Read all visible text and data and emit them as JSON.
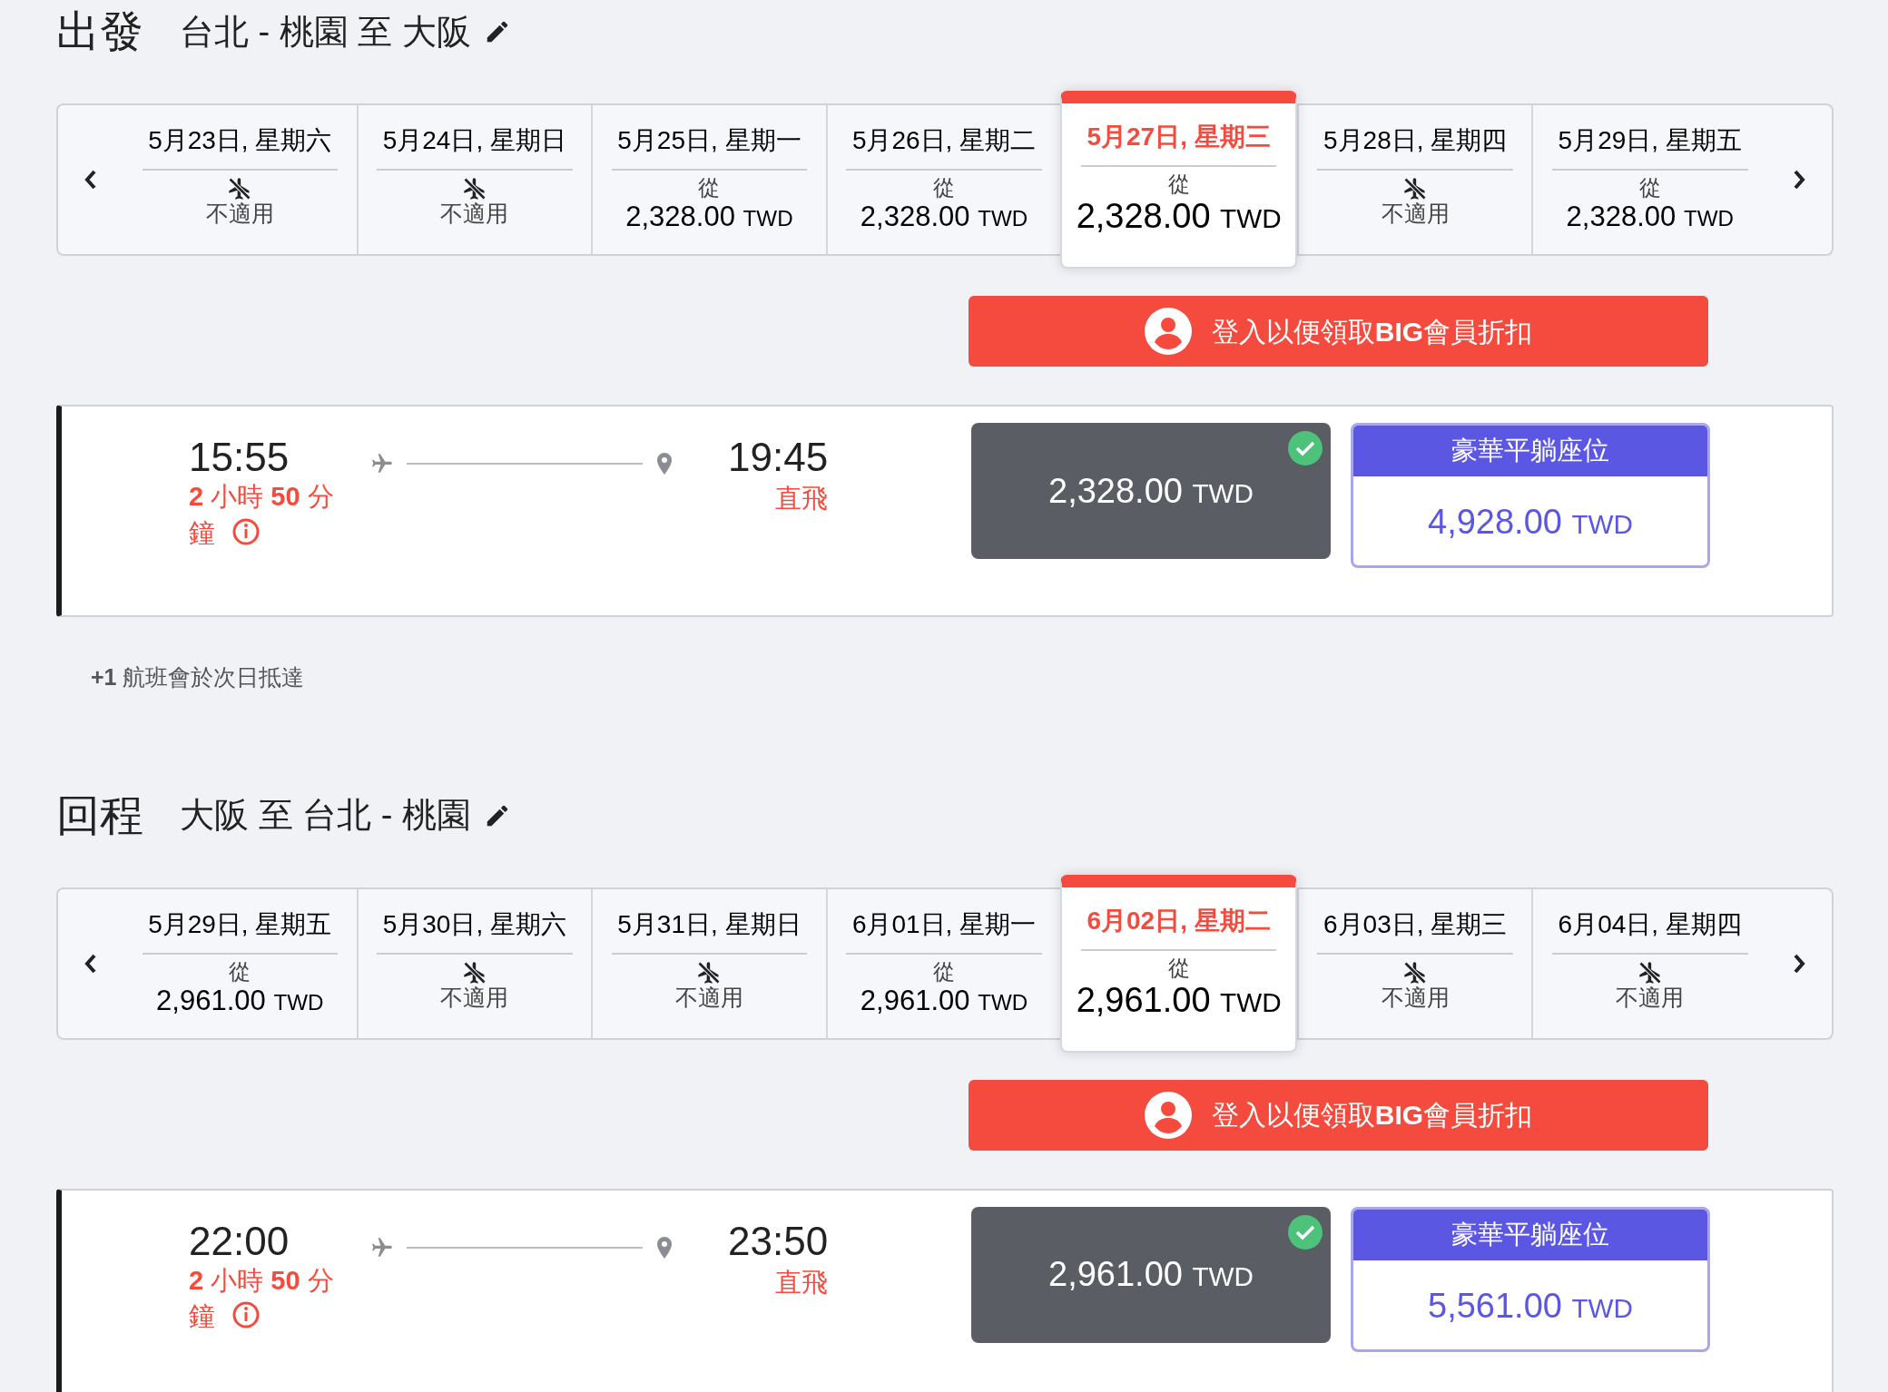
{
  "sections": [
    {
      "label": "出發",
      "route": "台北 - 桃園 至 大阪",
      "dates": [
        {
          "date": "5月23日, 星期六",
          "kind": "unavailable",
          "text": "不適用",
          "selected": false
        },
        {
          "date": "5月24日, 星期日",
          "kind": "unavailable",
          "text": "不適用",
          "selected": false
        },
        {
          "date": "5月25日, 星期一",
          "kind": "fare",
          "from": "從",
          "amount": "2,328.00",
          "currency": "TWD",
          "selected": false
        },
        {
          "date": "5月26日, 星期二",
          "kind": "fare",
          "from": "從",
          "amount": "2,328.00",
          "currency": "TWD",
          "selected": false
        },
        {
          "date": "5月27日, 星期三",
          "kind": "fare",
          "from": "從",
          "amount": "2,328.00",
          "currency": "TWD",
          "selected": true
        },
        {
          "date": "5月28日, 星期四",
          "kind": "unavailable",
          "text": "不適用",
          "selected": false
        },
        {
          "date": "5月29日, 星期五",
          "kind": "fare",
          "from": "從",
          "amount": "2,328.00",
          "currency": "TWD",
          "selected": false
        }
      ],
      "login_button": "登入以便領取**BIG**會員折扣",
      "flight": {
        "depart": "15:55",
        "duration": "**2** 小時 **50** 分鐘",
        "arrive": "19:45",
        "stops": "直飛",
        "fares": [
          {
            "kind": "standard",
            "amount": "2,328.00",
            "currency": "TWD",
            "selected": true
          },
          {
            "kind": "premium",
            "header": "豪華平躺座位",
            "amount": "4,928.00",
            "currency": "TWD",
            "selected": false
          }
        ]
      },
      "note": "**+1** 航班會於次日抵達"
    },
    {
      "label": "回程",
      "route": "大阪 至 台北 - 桃園",
      "dates": [
        {
          "date": "5月29日, 星期五",
          "kind": "fare",
          "from": "從",
          "amount": "2,961.00",
          "currency": "TWD",
          "selected": false
        },
        {
          "date": "5月30日, 星期六",
          "kind": "unavailable",
          "text": "不適用",
          "selected": false
        },
        {
          "date": "5月31日, 星期日",
          "kind": "unavailable",
          "text": "不適用",
          "selected": false
        },
        {
          "date": "6月01日, 星期一",
          "kind": "fare",
          "from": "從",
          "amount": "2,961.00",
          "currency": "TWD",
          "selected": false
        },
        {
          "date": "6月02日, 星期二",
          "kind": "fare",
          "from": "從",
          "amount": "2,961.00",
          "currency": "TWD",
          "selected": true
        },
        {
          "date": "6月03日, 星期三",
          "kind": "unavailable",
          "text": "不適用",
          "selected": false
        },
        {
          "date": "6月04日, 星期四",
          "kind": "unavailable",
          "text": "不適用",
          "selected": false
        }
      ],
      "login_button": "登入以便領取**BIG**會員折扣",
      "flight": {
        "depart": "22:00",
        "duration": "**2** 小時 **50** 分鐘",
        "arrive": "23:50",
        "stops": "直飛",
        "fares": [
          {
            "kind": "standard",
            "amount": "2,961.00",
            "currency": "TWD",
            "selected": true
          },
          {
            "kind": "premium",
            "header": "豪華平躺座位",
            "amount": "5,561.00",
            "currency": "TWD",
            "selected": false
          }
        ]
      }
    }
  ]
}
